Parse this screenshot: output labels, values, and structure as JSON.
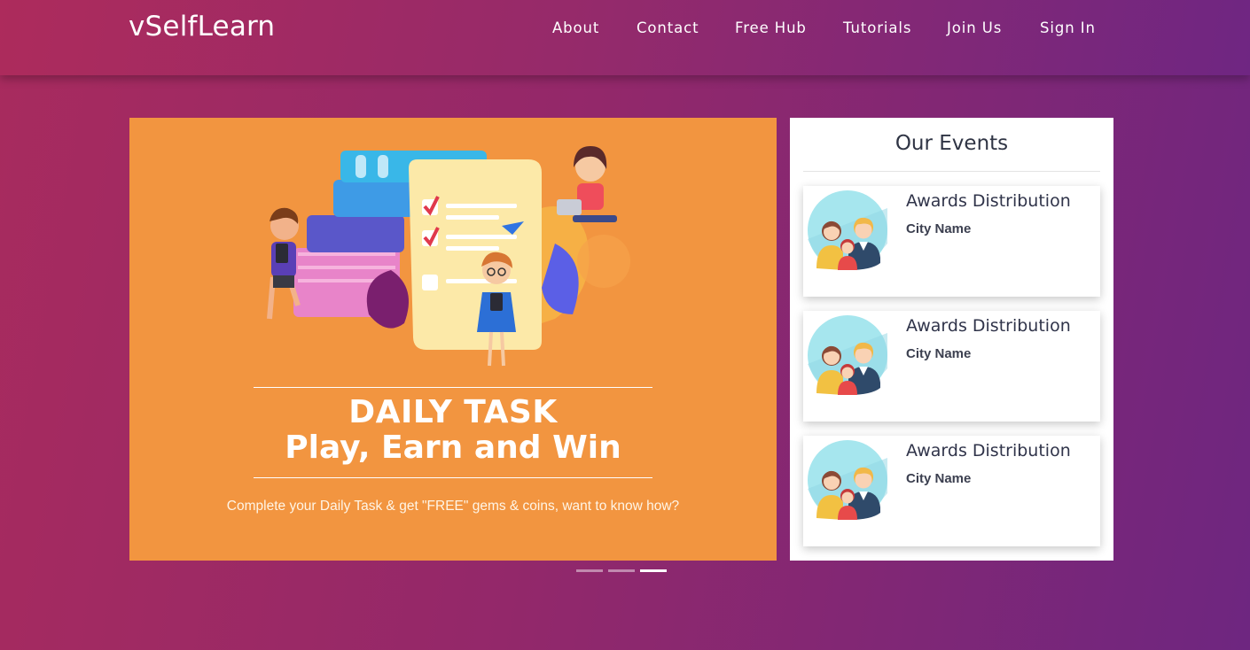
{
  "brand": "vSelfLearn",
  "nav": {
    "items": [
      {
        "label": "About"
      },
      {
        "label": "Contact"
      },
      {
        "label": "Free Hub"
      },
      {
        "label": "Tutorials"
      },
      {
        "label": "Join Us"
      },
      {
        "label": "Sign In"
      }
    ]
  },
  "slider": {
    "headline1": "DAILY TASK",
    "headline2": "Play, Earn and Win",
    "subtext": "Complete your Daily Task & get \"FREE\" gems & coins, want to know how?",
    "background_color": "#f29540",
    "indicator_count": 3,
    "active_indicator": 3
  },
  "events": {
    "title": "Our Events",
    "items": [
      {
        "title": "Awards Distribution",
        "city": "City Name",
        "icon": "family-avatar-icon"
      },
      {
        "title": "Awards Distribution",
        "city": "City Name",
        "icon": "family-avatar-icon"
      },
      {
        "title": "Awards Distribution",
        "city": "City Name",
        "icon": "family-avatar-icon"
      }
    ]
  },
  "colors": {
    "gradient_start": "#a82b5e",
    "gradient_end": "#6e2680",
    "slide_orange": "#f29540"
  }
}
